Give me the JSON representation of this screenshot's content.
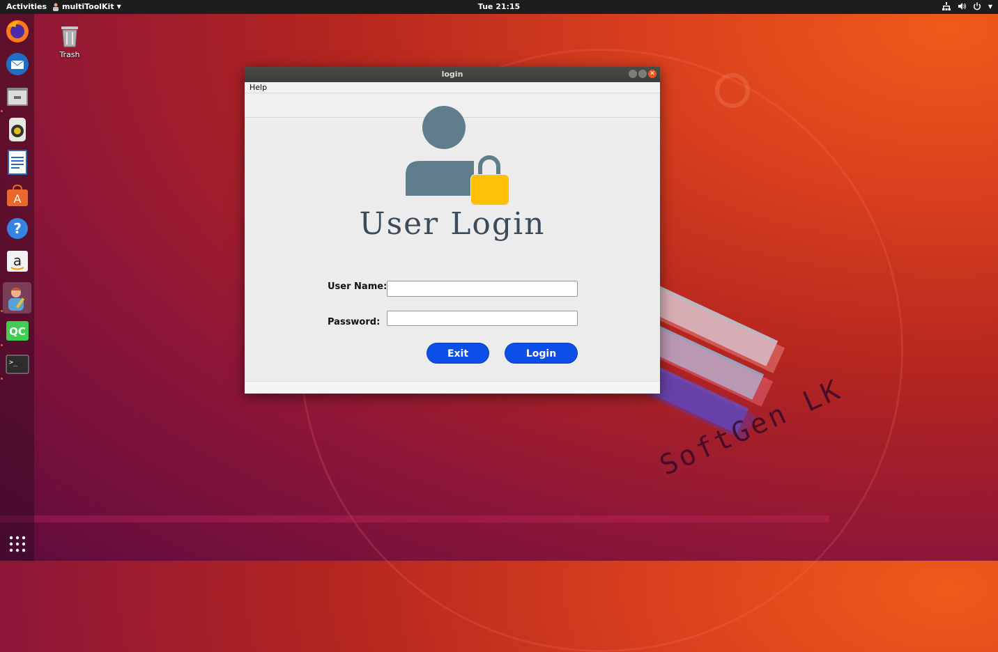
{
  "topbar": {
    "activities": "Activities",
    "app_name": "multiToolKit",
    "clock": "Tue 21:15"
  },
  "desktop": {
    "trash_label": "Trash",
    "watermark": "SoftGen LK"
  },
  "dock": {
    "items": [
      "firefox-icon",
      "thunderbird-icon",
      "files-icon",
      "rhythmbox-icon",
      "writer-icon",
      "software-icon",
      "help-icon",
      "amazon-icon",
      "multitoolkit-icon",
      "qtcreator-icon",
      "terminal-icon"
    ],
    "show_apps": "show-applications-icon"
  },
  "window": {
    "title": "login",
    "menu_help": "Help",
    "heading": "User Login",
    "username_label": "User Name:",
    "username_value": "",
    "password_label": "Password:",
    "password_value": "",
    "exit_label": "Exit",
    "login_label": "Login"
  },
  "colors": {
    "button_blue": "#0b4fe6",
    "avatar_gray": "#607d8b",
    "lock_yellow": "#ffc107"
  }
}
